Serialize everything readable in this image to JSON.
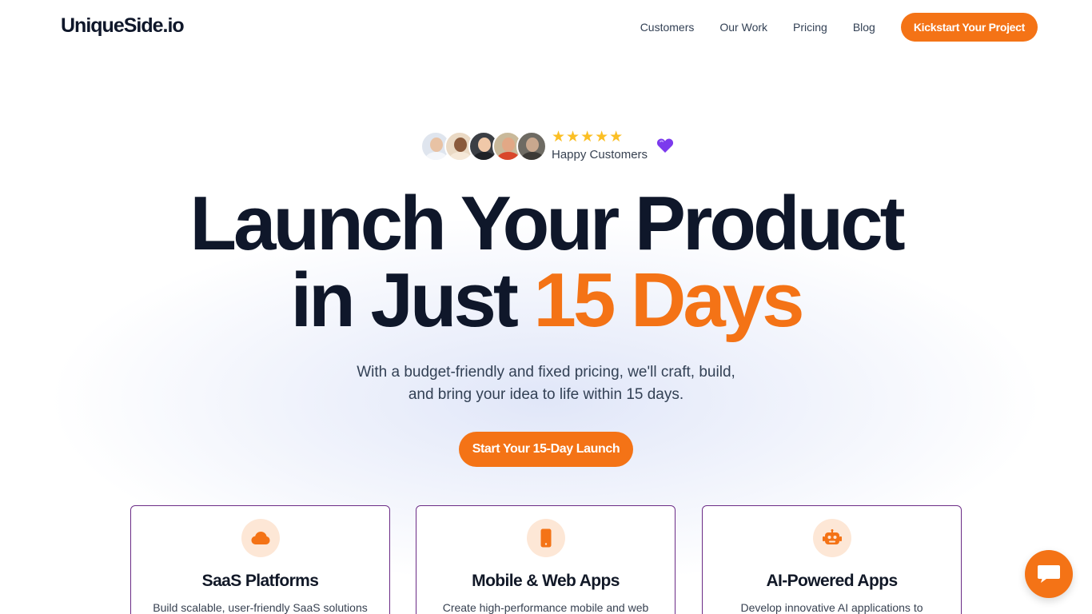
{
  "brand": {
    "logo": "UniqueSide.io",
    "accent_color": "#f47316",
    "card_border_color": "#6b2b86"
  },
  "nav": {
    "links": [
      "Customers",
      "Our Work",
      "Pricing",
      "Blog"
    ],
    "cta": "Kickstart Your Project"
  },
  "proof": {
    "stars": "★★★★★",
    "rating": 5,
    "label": "Happy Customers",
    "heart_icon": "purple-heart-icon"
  },
  "hero": {
    "title_line1": "Launch Your Product",
    "title_line2_prefix": "in Just",
    "title_line2_accent": "15 Days",
    "subtitle_line1": "With a budget-friendly and fixed pricing, we'll craft, build,",
    "subtitle_line2": "and bring your idea to life within 15 days.",
    "cta": "Start Your 15-Day Launch"
  },
  "cards": [
    {
      "icon": "cloud-icon",
      "title": "SaaS Platforms",
      "desc": "Build scalable, user-friendly SaaS solutions"
    },
    {
      "icon": "mobile-icon",
      "title": "Mobile & Web Apps",
      "desc": "Create high-performance mobile and web"
    },
    {
      "icon": "robot-icon",
      "title": "AI-Powered Apps",
      "desc": "Develop innovative AI applications to"
    }
  ],
  "chat": {
    "icon": "chat-bubble-icon"
  }
}
